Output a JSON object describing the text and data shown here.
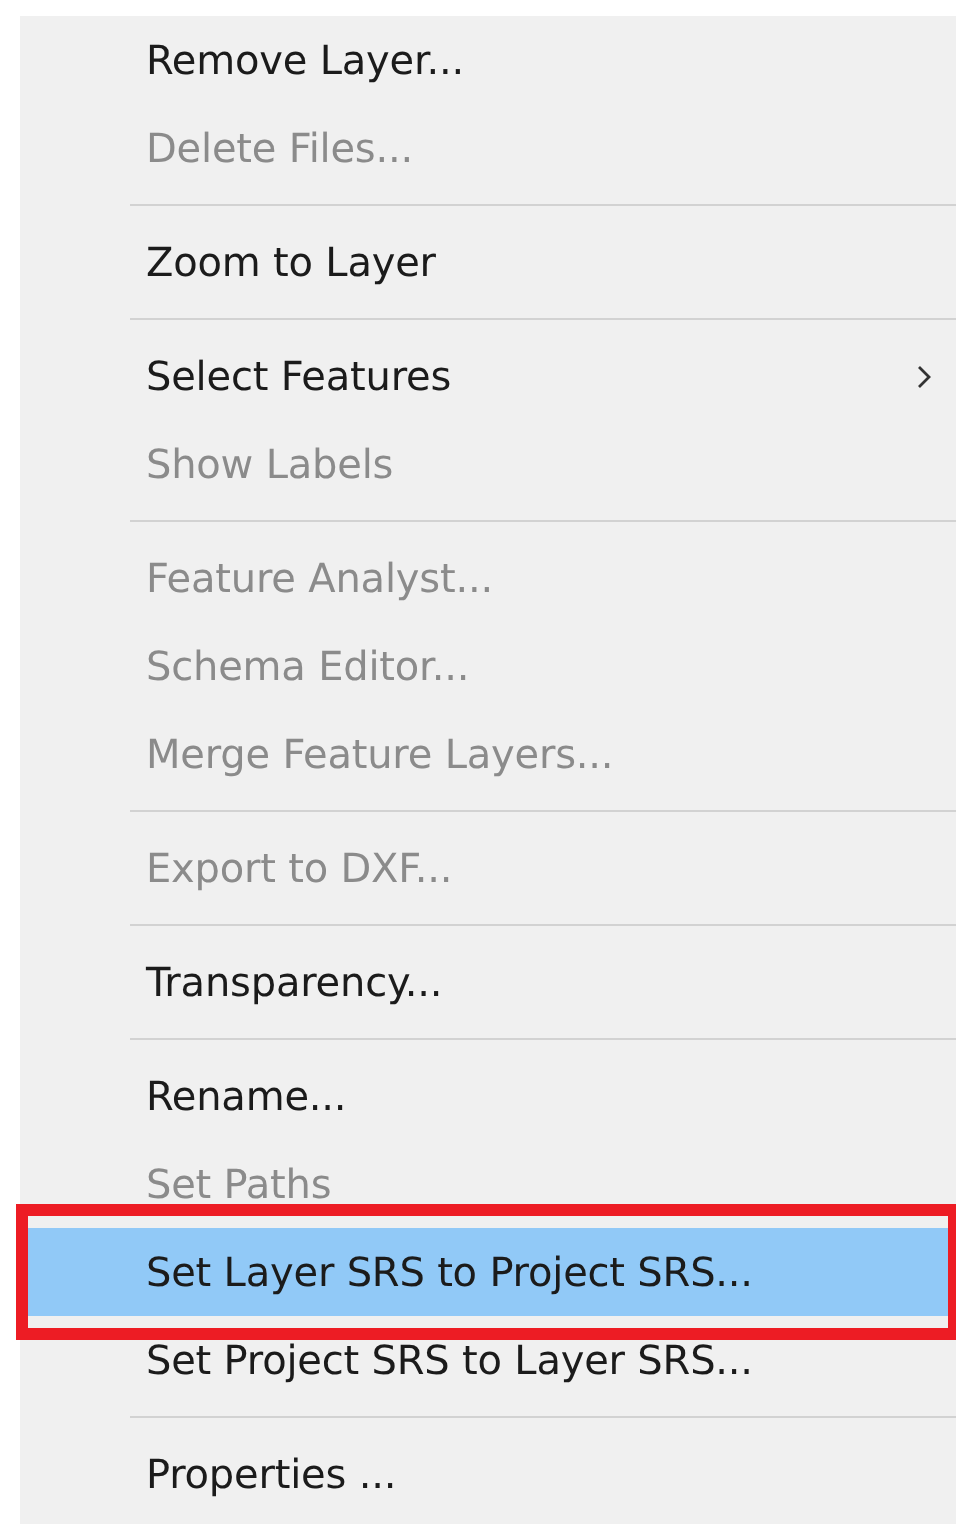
{
  "context_menu": {
    "groups": [
      {
        "items": [
          {
            "label": "Remove Layer...",
            "disabled": false,
            "selected": false
          },
          {
            "label": "Delete Files...",
            "disabled": true,
            "selected": false
          }
        ]
      },
      {
        "items": [
          {
            "label": "Zoom to Layer",
            "disabled": false,
            "selected": false
          }
        ]
      },
      {
        "items": [
          {
            "label": "Select Features",
            "disabled": false,
            "selected": false,
            "has_submenu": true
          },
          {
            "label": "Show Labels",
            "disabled": true,
            "selected": false
          }
        ]
      },
      {
        "items": [
          {
            "label": "Feature Analyst...",
            "disabled": true,
            "selected": false
          },
          {
            "label": "Schema Editor...",
            "disabled": true,
            "selected": false
          },
          {
            "label": "Merge Feature Layers...",
            "disabled": true,
            "selected": false
          }
        ]
      },
      {
        "items": [
          {
            "label": "Export to DXF...",
            "disabled": true,
            "selected": false
          }
        ]
      },
      {
        "items": [
          {
            "label": "Transparency...",
            "disabled": false,
            "selected": false
          }
        ]
      },
      {
        "items": [
          {
            "label": "Rename...",
            "disabled": false,
            "selected": false
          },
          {
            "label": "Set Paths",
            "disabled": true,
            "selected": false
          },
          {
            "label": "Set Layer SRS to Project SRS...",
            "disabled": false,
            "selected": true,
            "annotated": true
          },
          {
            "label": "Set Project SRS to Layer SRS...",
            "disabled": false,
            "selected": false
          }
        ]
      },
      {
        "items": [
          {
            "label": "Properties ...",
            "disabled": false,
            "selected": false
          }
        ]
      }
    ]
  }
}
